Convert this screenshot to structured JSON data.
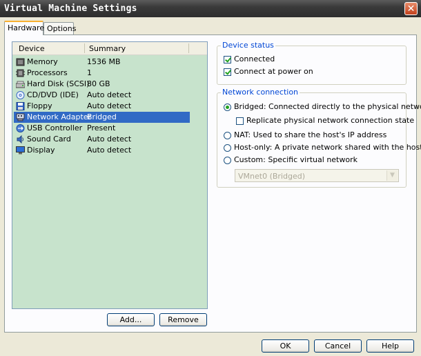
{
  "window": {
    "title": "Virtual Machine Settings",
    "close_glyph": "✕"
  },
  "tabs": [
    {
      "label": "Hardware"
    },
    {
      "label": "Options"
    }
  ],
  "device_list": {
    "headers": {
      "device": "Device",
      "summary": "Summary"
    },
    "rows": [
      {
        "device": "Memory",
        "summary": "1536 MB",
        "icon": "memory-icon"
      },
      {
        "device": "Processors",
        "summary": "1",
        "icon": "processor-icon"
      },
      {
        "device": "Hard Disk (SCSI)",
        "summary": "80 GB",
        "icon": "hard-disk-icon"
      },
      {
        "device": "CD/DVD (IDE)",
        "summary": "Auto detect",
        "icon": "cd-dvd-icon"
      },
      {
        "device": "Floppy",
        "summary": "Auto detect",
        "icon": "floppy-icon"
      },
      {
        "device": "Network Adapter",
        "summary": "Bridged",
        "icon": "network-adapter-icon",
        "selected": true
      },
      {
        "device": "USB Controller",
        "summary": "Present",
        "icon": "usb-icon"
      },
      {
        "device": "Sound Card",
        "summary": "Auto detect",
        "icon": "sound-card-icon"
      },
      {
        "device": "Display",
        "summary": "Auto detect",
        "icon": "display-icon"
      }
    ]
  },
  "buttons": {
    "add": "Add...",
    "remove": "Remove",
    "ok": "OK",
    "cancel": "Cancel",
    "help": "Help"
  },
  "device_status": {
    "legend": "Device status",
    "connected": {
      "label": "Connected",
      "checked": true
    },
    "connect_at_power_on": {
      "label": "Connect at power on",
      "checked": true
    }
  },
  "network_connection": {
    "legend": "Network connection",
    "bridged": {
      "label": "Bridged: Connected directly to the physical network",
      "selected": true
    },
    "replicate": {
      "label": "Replicate physical network connection state",
      "checked": false
    },
    "nat": {
      "label": "NAT: Used to share the host's IP address",
      "selected": false
    },
    "host_only": {
      "label": "Host-only: A private network shared with the host",
      "selected": false
    },
    "custom": {
      "label": "Custom: Specific virtual network",
      "selected": false
    },
    "vmnet_select": {
      "value": "VMnet0 (Bridged)",
      "disabled": true
    }
  },
  "colors": {
    "list_background": "#c7e3cc",
    "selection": "#316ac5",
    "legend": "#0046d5",
    "title_bar": "#3a3a3a"
  }
}
